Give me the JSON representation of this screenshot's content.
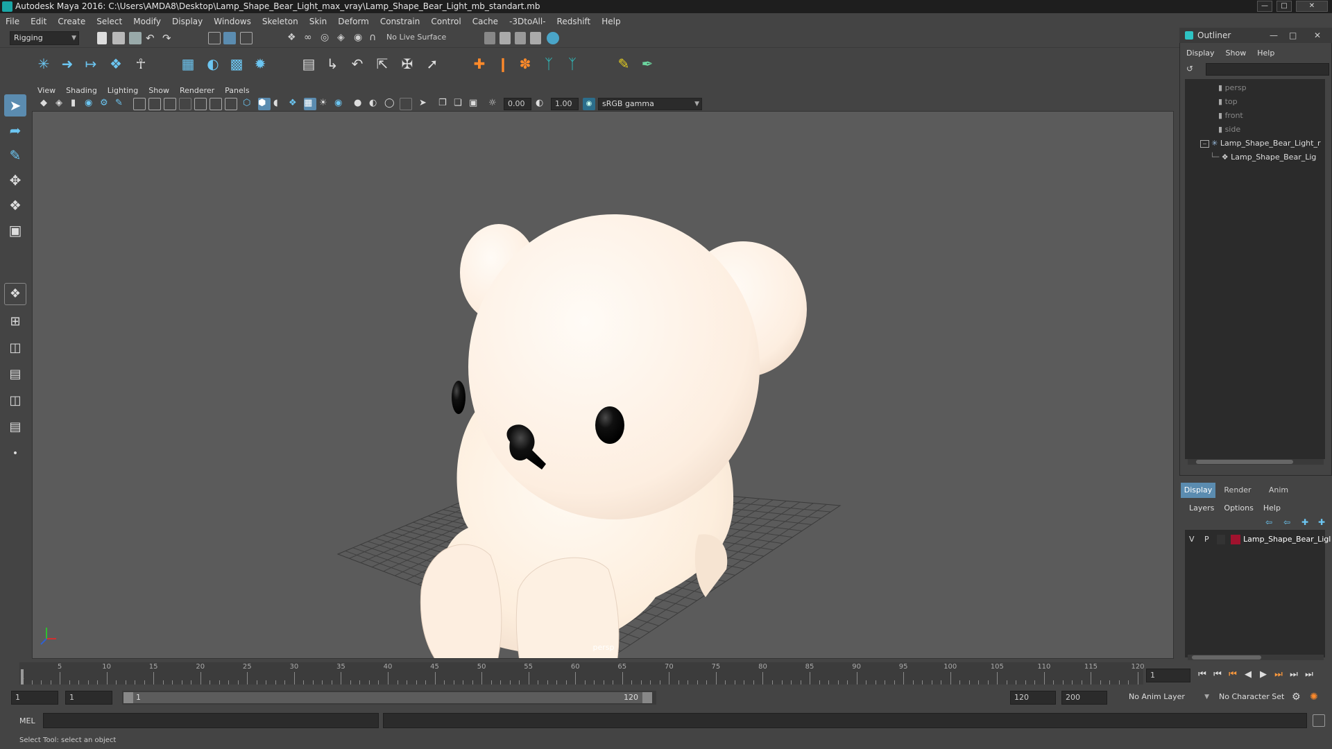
{
  "window": {
    "title": "Autodesk Maya 2016: C:\\Users\\AMDA8\\Desktop\\Lamp_Shape_Bear_Light_max_vray\\Lamp_Shape_Bear_Light_mb_standart.mb"
  },
  "menubar": [
    "File",
    "Edit",
    "Create",
    "Select",
    "Modify",
    "Display",
    "Windows",
    "Skeleton",
    "Skin",
    "Deform",
    "Constrain",
    "Control",
    "Cache",
    "-3DtoAll-",
    "Redshift",
    "Help"
  ],
  "statusline": {
    "mode": "Rigging",
    "live_surface": "No Live Surface"
  },
  "viewport": {
    "menu": [
      "View",
      "Shading",
      "Lighting",
      "Show",
      "Renderer",
      "Panels"
    ],
    "exposure": "0.00",
    "gamma": "1.00",
    "color_space": "sRGB gamma",
    "camera_label": "persp",
    "bear_color": "#fdf0e2"
  },
  "outliner": {
    "title": "Outliner",
    "menu": [
      "Display",
      "Show",
      "Help"
    ],
    "items": [
      {
        "label": "persp",
        "dim": true
      },
      {
        "label": "top",
        "dim": true
      },
      {
        "label": "front",
        "dim": true
      },
      {
        "label": "side",
        "dim": true
      },
      {
        "label": "Lamp_Shape_Bear_Light_r",
        "dim": false
      },
      {
        "label": "Lamp_Shape_Bear_Lig",
        "dim": false
      }
    ]
  },
  "layers": {
    "tabs": [
      "Display",
      "Render",
      "Anim"
    ],
    "menu": [
      "Layers",
      "Options",
      "Help"
    ],
    "row": {
      "v": "V",
      "p": "P",
      "name": "Lamp_Shape_Bear_Ligl",
      "color": "#a0122e"
    }
  },
  "timeline": {
    "ticks": [
      "5",
      "10",
      "15",
      "20",
      "25",
      "30",
      "35",
      "40",
      "45",
      "50",
      "55",
      "60",
      "65",
      "70",
      "75",
      "80",
      "85",
      "90",
      "95",
      "100",
      "105",
      "110",
      "115",
      "120"
    ],
    "first_frame": "1",
    "start": 1,
    "end": 120,
    "current_frame": "1"
  },
  "range": {
    "start_field": "1",
    "playback_start": "1",
    "slider_start": "1",
    "slider_end": "120",
    "playback_end": "120",
    "end_field": "200",
    "anim_layer": "No Anim Layer",
    "character_set": "No Character Set"
  },
  "cmdline": {
    "label": "MEL"
  },
  "helpline": {
    "text": "Select Tool: select an object"
  }
}
